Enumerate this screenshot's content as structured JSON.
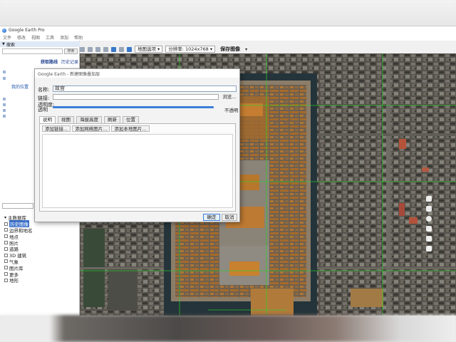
{
  "app": {
    "title": "Google Earth Pro",
    "menu": [
      "文件",
      "修改",
      "视图",
      "工具",
      "添加",
      "帮助"
    ]
  },
  "toolbar": {
    "map_select": "地图选项",
    "resolution_select": "分辨率: 1024x768",
    "save_image_button": "保存图像"
  },
  "sidebar": {
    "search_header": "搜索",
    "search_button": "搜索",
    "directions_link": "获取路线",
    "history_link": "历史记录",
    "my_places": "我的位置",
    "layers": [
      "主数据库",
      "历史图像",
      "边界和地名",
      "地点",
      "照片",
      "道路",
      "3D 建筑",
      "气象",
      "图片库",
      "更多",
      "地形"
    ]
  },
  "dialog": {
    "title": "Google Earth - 新建图像叠加层",
    "name_label": "名称:",
    "name_value": "故宫",
    "link_label": "链接:",
    "browse_button": "浏览...",
    "opacity_label_1": "透明度:",
    "opacity_label_2": "透明",
    "opacity_max": "不透明",
    "tabs": [
      "说明",
      "视图",
      "海拔高度",
      "刷新",
      "位置"
    ],
    "panel_buttons": [
      "添加链接...",
      "添加网络图片...",
      "添加本地图片..."
    ],
    "ok_button": "确定",
    "cancel_button": "取消"
  },
  "colors": {
    "accent": "#3b7fd8",
    "palace_roof": "#b9782f",
    "moat": "#2a3f46",
    "grid_line": "#2bd12b"
  }
}
